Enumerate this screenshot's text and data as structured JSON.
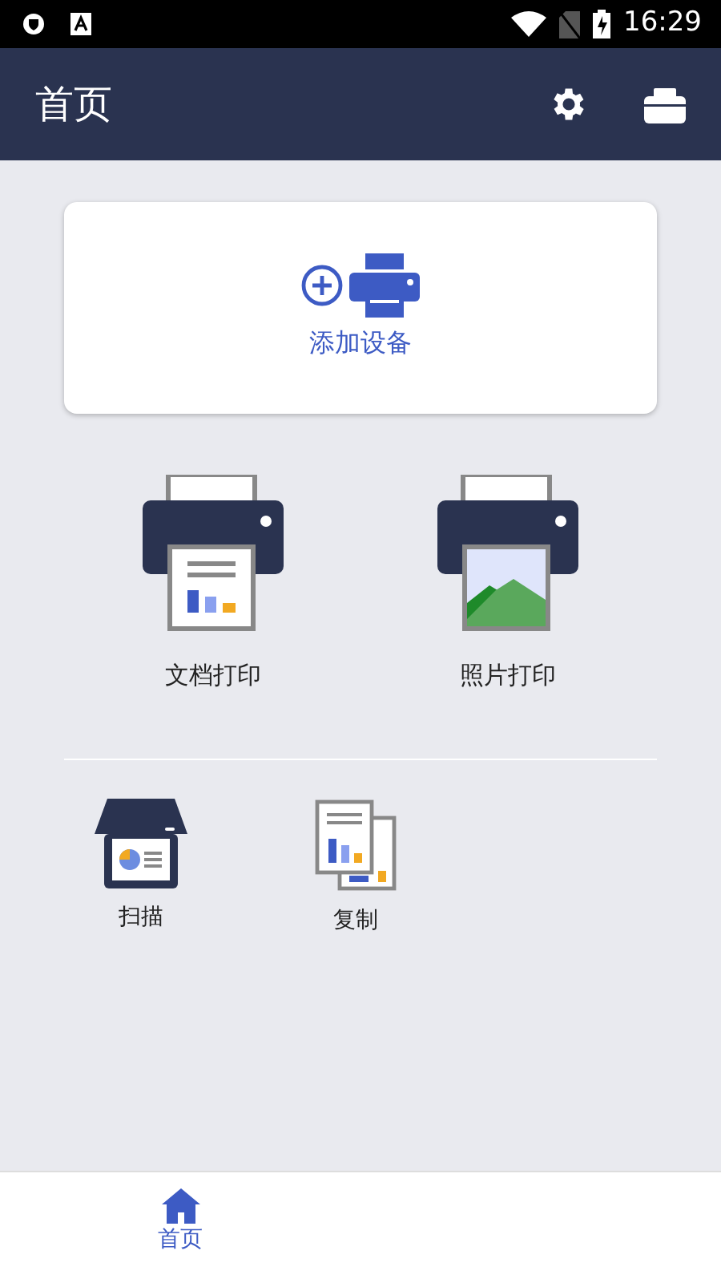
{
  "status_bar": {
    "time": "16:29"
  },
  "app_bar": {
    "title": "首页"
  },
  "add_device": {
    "label": "添加设备"
  },
  "print_options": [
    {
      "kind": "document",
      "label": "文档打印"
    },
    {
      "kind": "photo",
      "label": "照片打印"
    }
  ],
  "tools": [
    {
      "kind": "scan",
      "label": "扫描"
    },
    {
      "kind": "copy",
      "label": "复制"
    }
  ],
  "bottom_nav": [
    {
      "label": "首页",
      "selected": true
    }
  ]
}
